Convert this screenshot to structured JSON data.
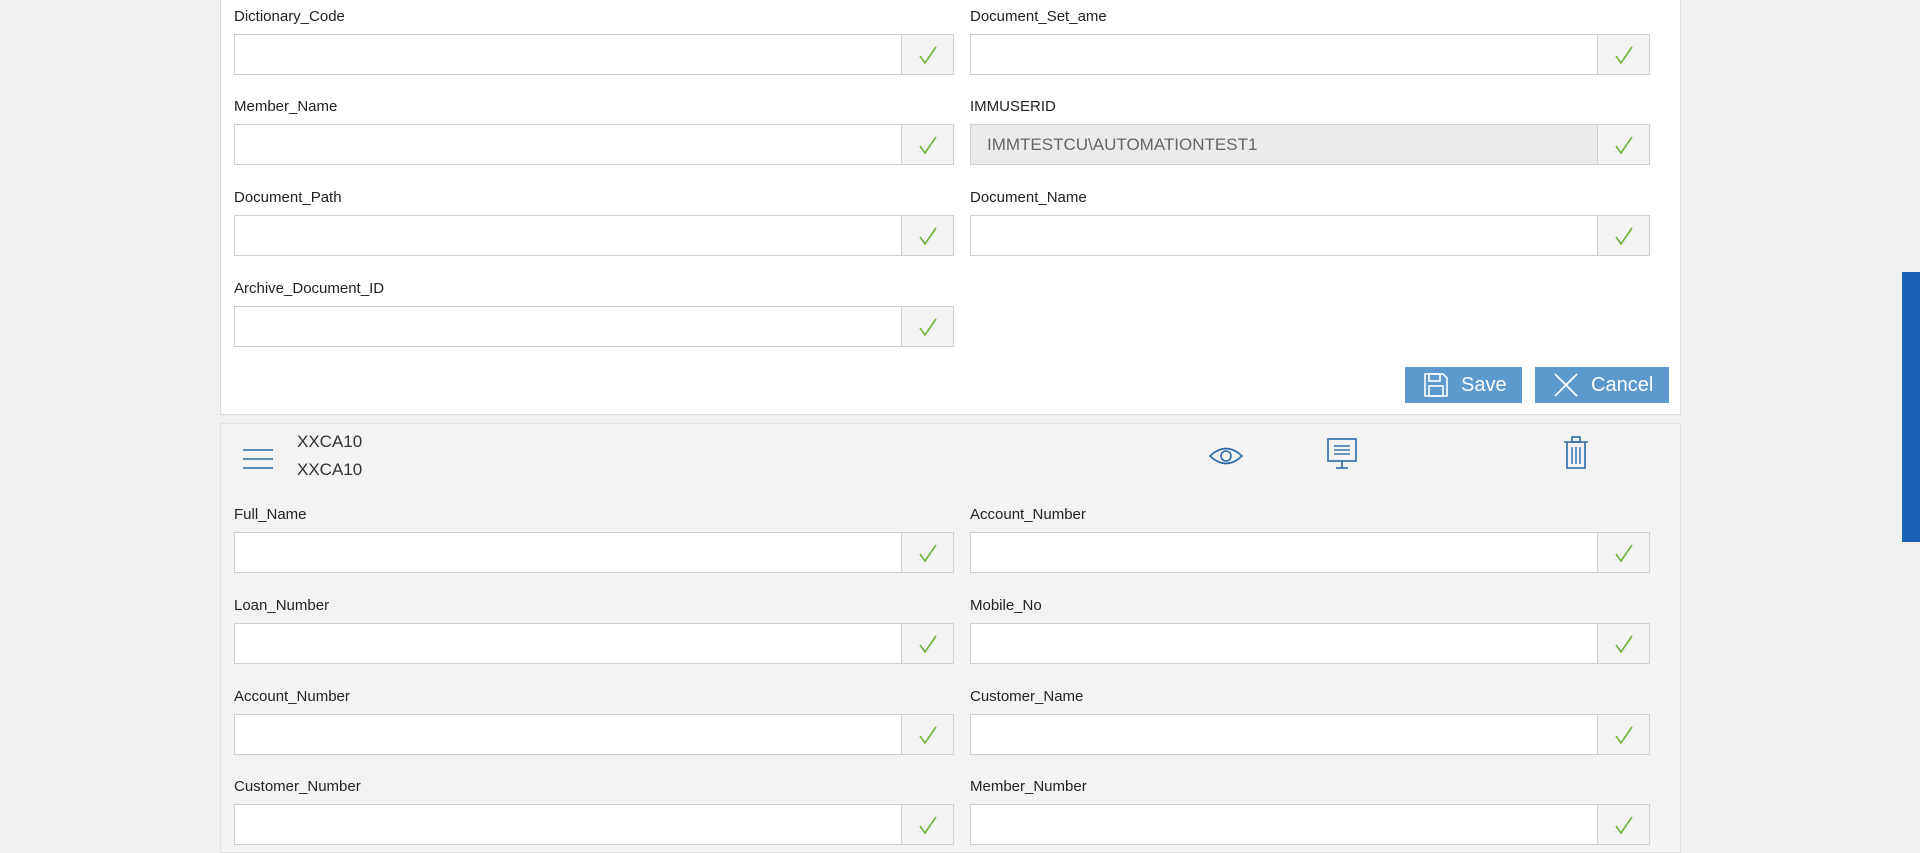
{
  "top_form": {
    "fields": [
      {
        "label": "Dictionary_Code",
        "value": ""
      },
      {
        "label": "Document_Set_ame",
        "value": ""
      },
      {
        "label": "Member_Name",
        "value": ""
      },
      {
        "label": "IMMUSERID",
        "value": "IMMTESTCU\\AUTOMATIONTEST1"
      },
      {
        "label": "Document_Path",
        "value": ""
      },
      {
        "label": "Document_Name",
        "value": ""
      },
      {
        "label": "Archive_Document_ID",
        "value": ""
      }
    ],
    "save_label": "Save",
    "cancel_label": "Cancel"
  },
  "document_card": {
    "title_line1": "XXCA10",
    "title_line2": "XXCA10",
    "icons": [
      "menu-icon",
      "eye-icon",
      "monitor-icon",
      "trash-icon"
    ],
    "fields": [
      {
        "label": "Full_Name",
        "value": ""
      },
      {
        "label": "Account_Number",
        "value": ""
      },
      {
        "label": "Loan_Number",
        "value": ""
      },
      {
        "label": "Mobile_No",
        "value": ""
      },
      {
        "label": "Account_Number",
        "value": ""
      },
      {
        "label": "Customer_Name",
        "value": ""
      },
      {
        "label": "Customer_Number",
        "value": ""
      },
      {
        "label": "Member_Number",
        "value": ""
      }
    ]
  },
  "colors": {
    "accent": "#5d98ce",
    "check": "#6bb33a",
    "icon": "#2b6aa8",
    "scrollbar": "#1a62b3"
  }
}
